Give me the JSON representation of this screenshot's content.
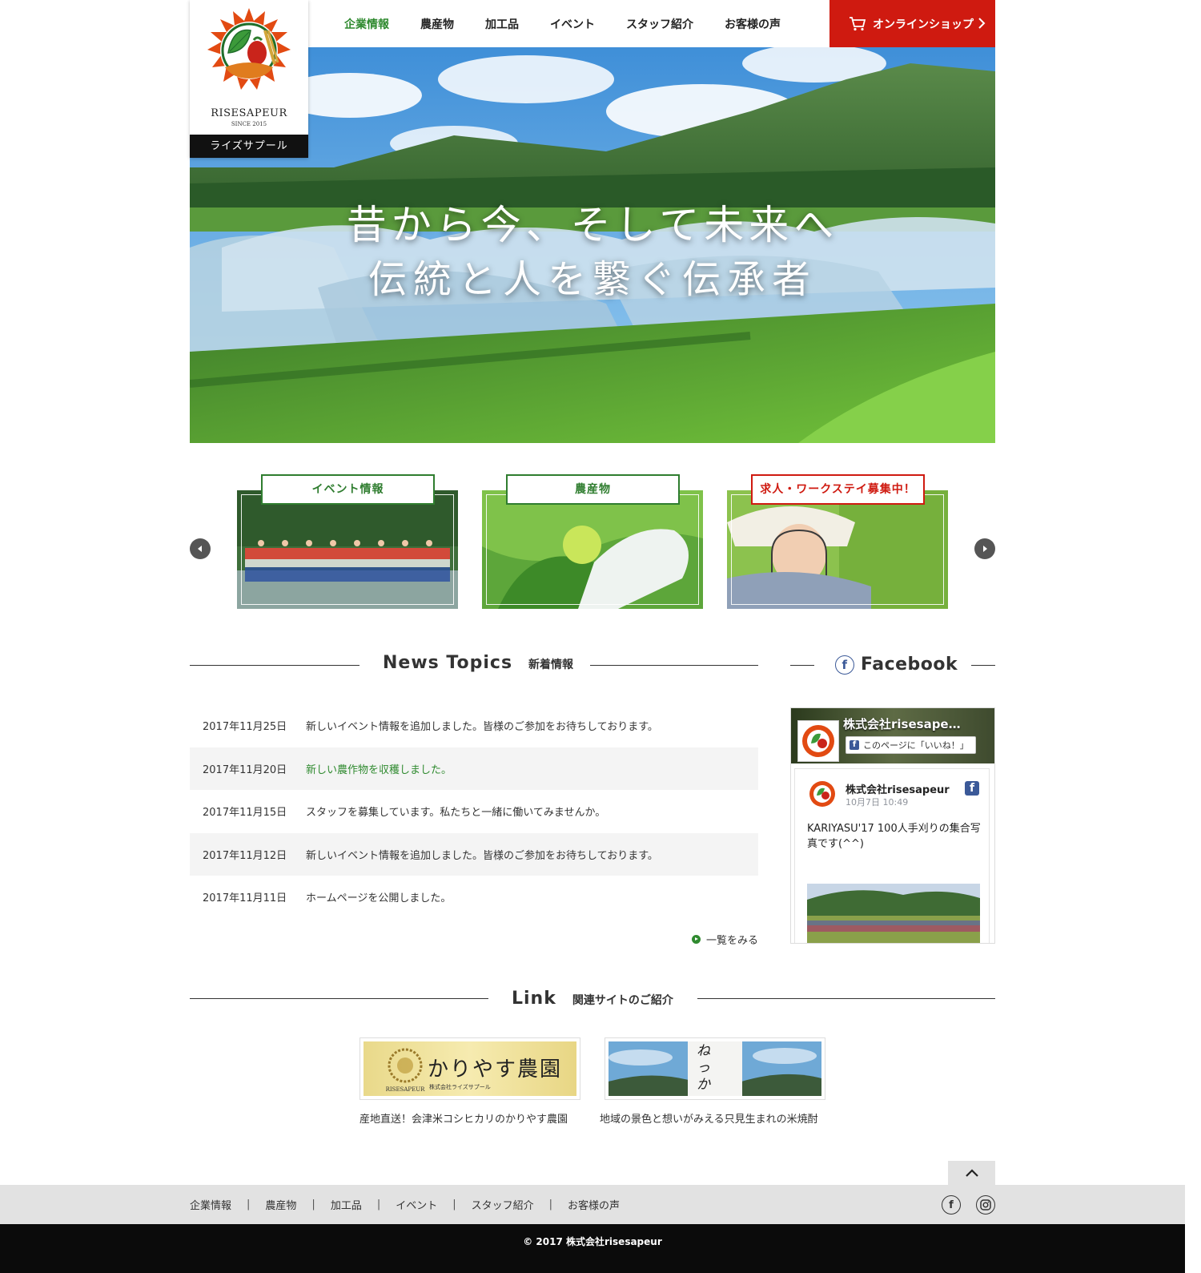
{
  "header": {
    "logo_name": "RISESAPEUR",
    "logo_since": "SINCE 2015",
    "logo_kana": "ライズサプール",
    "nav": [
      {
        "label": "企業情報"
      },
      {
        "label": "農産物"
      },
      {
        "label": "加工品"
      },
      {
        "label": "イベント"
      },
      {
        "label": "スタッフ紹介"
      },
      {
        "label": "お客様の声"
      }
    ],
    "shop_label": "オンラインショップ"
  },
  "hero": {
    "line1": "昔から今、そして未来へ",
    "line2": "伝統と人を繋ぐ伝承者"
  },
  "carousel": {
    "items": [
      {
        "label": "イベント情報"
      },
      {
        "label": "農産物"
      },
      {
        "label": "求人・ワークステイ募集中！"
      }
    ]
  },
  "news": {
    "title_en": "News Topics",
    "title_ja": "新着情報",
    "items": [
      {
        "date": "2017年11月25日",
        "text": "新しいイベント情報を追加しました。皆様のご参加をお待ちしております。"
      },
      {
        "date": "2017年11月20日",
        "text": "新しい農作物を収穫しました。"
      },
      {
        "date": "2017年11月15日",
        "text": "スタッフを募集しています。私たちと一緒に働いてみませんか。"
      },
      {
        "date": "2017年11月12日",
        "text": "新しいイベント情報を追加しました。皆様のご参加をお待ちしております。"
      },
      {
        "date": "2017年11月11日",
        "text": "ホームページを公開しました。"
      }
    ],
    "more_label": "一覧をみる"
  },
  "facebook": {
    "title": "Facebook",
    "cover_name": "株式会社risesape…",
    "like_label": "このページに「いいね！」",
    "post_name": "株式会社risesapeur",
    "post_date": "10月7日 10:49",
    "post_text": "KARIYASU'17 100人手刈りの集合写真です(^^)"
  },
  "links": {
    "title_en": "Link",
    "title_ja": "関連サイトのご紹介",
    "items": [
      {
        "banner": "かりやす農園",
        "banner_sub": "株式会社ライズサプール",
        "caption": "産地直送！会津米コシヒカリのかりやす農園"
      },
      {
        "banner": "ねっか",
        "caption": "地域の景色と想いがみえる只見生まれの米焼酎"
      }
    ]
  },
  "footer": {
    "nav": [
      {
        "label": "企業情報"
      },
      {
        "label": "農産物"
      },
      {
        "label": "加工品"
      },
      {
        "label": "イベント"
      },
      {
        "label": "スタッフ紹介"
      },
      {
        "label": "お客様の声"
      }
    ],
    "copyright": "© 2017 株式会社risesapeur"
  },
  "colors": {
    "accent_green": "#2f8a2f",
    "accent_red": "#cf1a10",
    "footer_gray": "#e2e2e2",
    "copyright_bg": "#0b0b0b"
  },
  "icons": [
    "cart-icon",
    "chevron-right-icon",
    "arrow-left-icon",
    "arrow-right-icon",
    "facebook-icon",
    "instagram-icon",
    "chevron-up-icon"
  ]
}
